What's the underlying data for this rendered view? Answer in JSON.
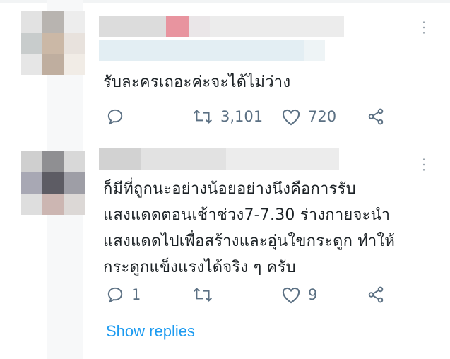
{
  "comments": [
    {
      "text_lines": [
        "รับละครเถอะค่ะจะได้ไม่ว่าง"
      ],
      "actions": {
        "reply_count": "",
        "retweet_count": "3,101",
        "like_count": "720"
      },
      "icons": [
        "reply-icon",
        "retweet-icon",
        "heart-icon",
        "share-icon",
        "more-options-icon"
      ]
    },
    {
      "text_lines": [
        "ก็มีที่ถูกนะอย่างน้อยอย่างนึงคือการรับ",
        "แสงแดดตอนเช้าช่วง7-7.30 ร่างกายจะนำ",
        "แสงแดดไปเพื่อสร้างและอุ่นใขกระดูก ทำให้",
        "กระดูกแข็งแรงได้จริง ๆ ครับ"
      ],
      "actions": {
        "reply_count": "1",
        "retweet_count": "",
        "like_count": "9"
      },
      "icons": [
        "reply-icon",
        "retweet-icon",
        "heart-icon",
        "share-icon",
        "more-options-icon"
      ]
    }
  ],
  "show_replies_label": "Show replies",
  "colors": {
    "link": "#1d9bf0",
    "icon": "#5b7083",
    "text": "#14171a"
  }
}
